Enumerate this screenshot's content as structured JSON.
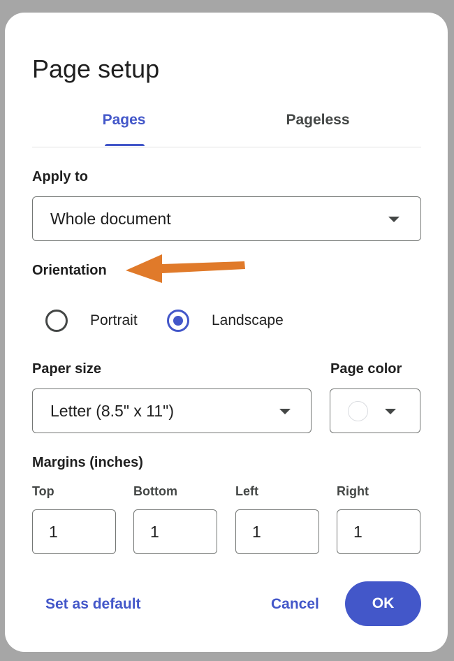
{
  "dialog": {
    "title": "Page setup"
  },
  "tabs": [
    {
      "label": "Pages",
      "selected": true
    },
    {
      "label": "Pageless",
      "selected": false
    }
  ],
  "apply_to": {
    "label": "Apply to",
    "value": "Whole document"
  },
  "orientation": {
    "label": "Orientation",
    "options": [
      {
        "label": "Portrait",
        "selected": false
      },
      {
        "label": "Landscape",
        "selected": true
      }
    ]
  },
  "paper_size": {
    "label": "Paper size",
    "value": "Letter (8.5\" x 11\")"
  },
  "page_color": {
    "label": "Page color",
    "value_color": "#ffffff"
  },
  "margins": {
    "label": "Margins (inches)",
    "fields": [
      {
        "label": "Top",
        "value": "1"
      },
      {
        "label": "Bottom",
        "value": "1"
      },
      {
        "label": "Left",
        "value": "1"
      },
      {
        "label": "Right",
        "value": "1"
      }
    ]
  },
  "footer": {
    "set_default_label": "Set as default",
    "cancel_label": "Cancel",
    "ok_label": "OK"
  },
  "annotation": {
    "arrow_color": "#e07a2a",
    "icon": "arrow-left-icon"
  },
  "colors": {
    "accent": "#4357c9",
    "backdrop": "#a6a6a6"
  }
}
